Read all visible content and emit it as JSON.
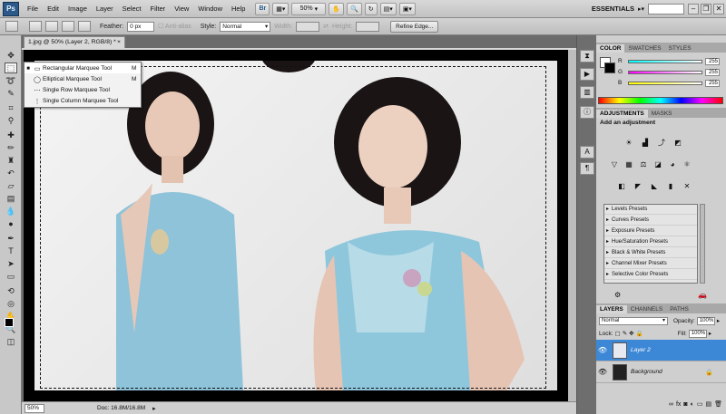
{
  "menubar": {
    "logo": "Ps",
    "items": [
      "File",
      "Edit",
      "Image",
      "Layer",
      "Select",
      "Filter",
      "View",
      "Window",
      "Help"
    ],
    "bridge_label": "Br",
    "zoom": "50%",
    "workspace": "ESSENTIALS",
    "window_minimize": "–",
    "window_restore": "❐",
    "window_close": "✕"
  },
  "options": {
    "feather_label": "Feather:",
    "feather_value": "0 px",
    "antialias_label": "Anti-alias",
    "style_label": "Style:",
    "style_value": "Normal",
    "width_label": "Width:",
    "height_label": "Height:",
    "refine_label": "Refine Edge..."
  },
  "document": {
    "tab_title": "1.jpg @ 50% (Layer 2, RGB/8) *",
    "tab_close": "×",
    "zoom": "50%",
    "doc_info": "Doc: 16.8M/16.8M"
  },
  "flyout": {
    "items": [
      {
        "label": "Rectangular Marquee Tool",
        "key": "M",
        "icon": "▭",
        "selected": true
      },
      {
        "label": "Elliptical Marquee Tool",
        "key": "M",
        "icon": "◯",
        "selected": false
      },
      {
        "label": "Single Row Marquee Tool",
        "key": "",
        "icon": "⋯",
        "selected": false
      },
      {
        "label": "Single Column Marquee Tool",
        "key": "",
        "icon": "⋮",
        "selected": false
      }
    ]
  },
  "color_panel": {
    "tabs": [
      "COLOR",
      "SWATCHES",
      "STYLES"
    ],
    "channels": [
      {
        "name": "R",
        "value": "255",
        "color": "#ff3b3b"
      },
      {
        "name": "G",
        "value": "255",
        "color": "#f044f0"
      },
      {
        "name": "B",
        "value": "255",
        "color": "#e8e800"
      }
    ]
  },
  "adjustments": {
    "tabs": [
      "ADJUSTMENTS",
      "MASKS"
    ],
    "heading": "Add an adjustment",
    "presets": [
      "Levels Presets",
      "Curves Presets",
      "Exposure Presets",
      "Hue/Saturation Presets",
      "Black & White Presets",
      "Channel Mixer Presets",
      "Selective Color Presets"
    ]
  },
  "layers": {
    "tabs": [
      "LAYERS",
      "CHANNELS",
      "PATHS"
    ],
    "blend_mode": "Normal",
    "opacity_label": "Opacity:",
    "opacity_value": "100%",
    "lock_label": "Lock:",
    "fill_label": "Fill:",
    "fill_value": "100%",
    "rows": [
      {
        "name": "Layer 2",
        "selected": true
      },
      {
        "name": "Background",
        "selected": false
      }
    ]
  },
  "icons": {
    "accent": "#3d88d6"
  }
}
